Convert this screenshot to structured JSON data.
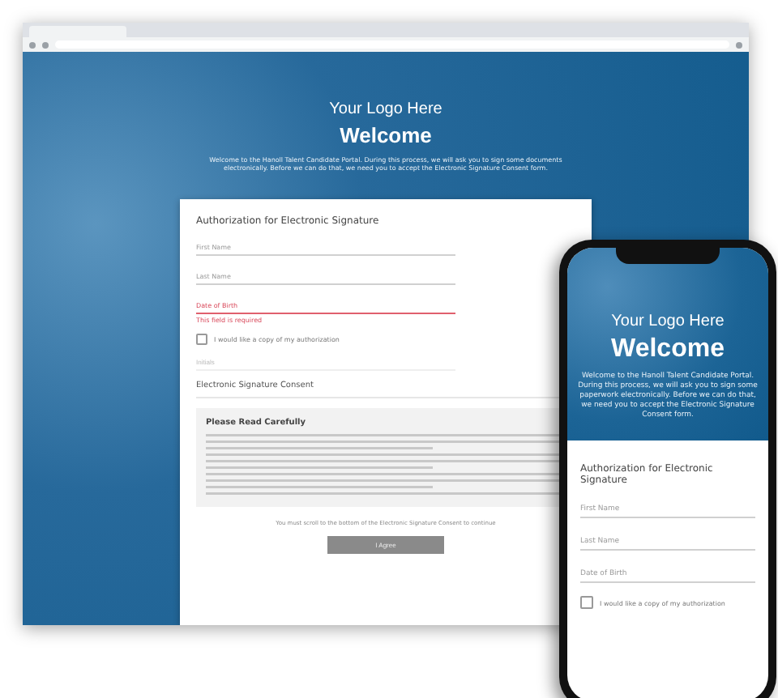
{
  "desktop": {
    "logo": "Your Logo Here",
    "heading": "Welcome",
    "intro": "Welcome to the Hanoll Talent Candidate Portal. During this process, we will ask you to sign some documents electronically. Before we can do that, we need you to accept the Electronic Signature Consent form.",
    "form_title": "Authorization for Electronic Signature",
    "fields": [
      {
        "label": "First Name",
        "invalid": false
      },
      {
        "label": "Last Name",
        "invalid": false
      },
      {
        "label": "Date of Birth",
        "invalid": true,
        "error": "This field is required"
      }
    ],
    "copy_checkbox": {
      "label": "I would like a copy of my authorization",
      "checked": false
    },
    "initials_field": {
      "placeholder": "Initials"
    },
    "consent_title": "Electronic Signature Consent",
    "consent_heading": "Please Read Carefully",
    "scroll_note": "You must scroll to the bottom of the Electronic Signature Consent to continue",
    "agree_button": {
      "label": "I Agree",
      "disabled": true
    }
  },
  "phone": {
    "logo": "Your Logo Here",
    "heading": "Welcome",
    "intro": "Welcome to the Hanoll Talent Candidate Portal. During this process, we will ask you to sign some paperwork electronically. Before we can do that, we need you to accept the Electronic Signature Consent form.",
    "form_title": "Authorization for Electronic Signature",
    "fields": [
      {
        "label": "First Name"
      },
      {
        "label": "Last Name"
      },
      {
        "label": "Date of Birth"
      }
    ],
    "copy_checkbox": {
      "label": "I would like a copy of my authorization",
      "checked": false
    }
  }
}
